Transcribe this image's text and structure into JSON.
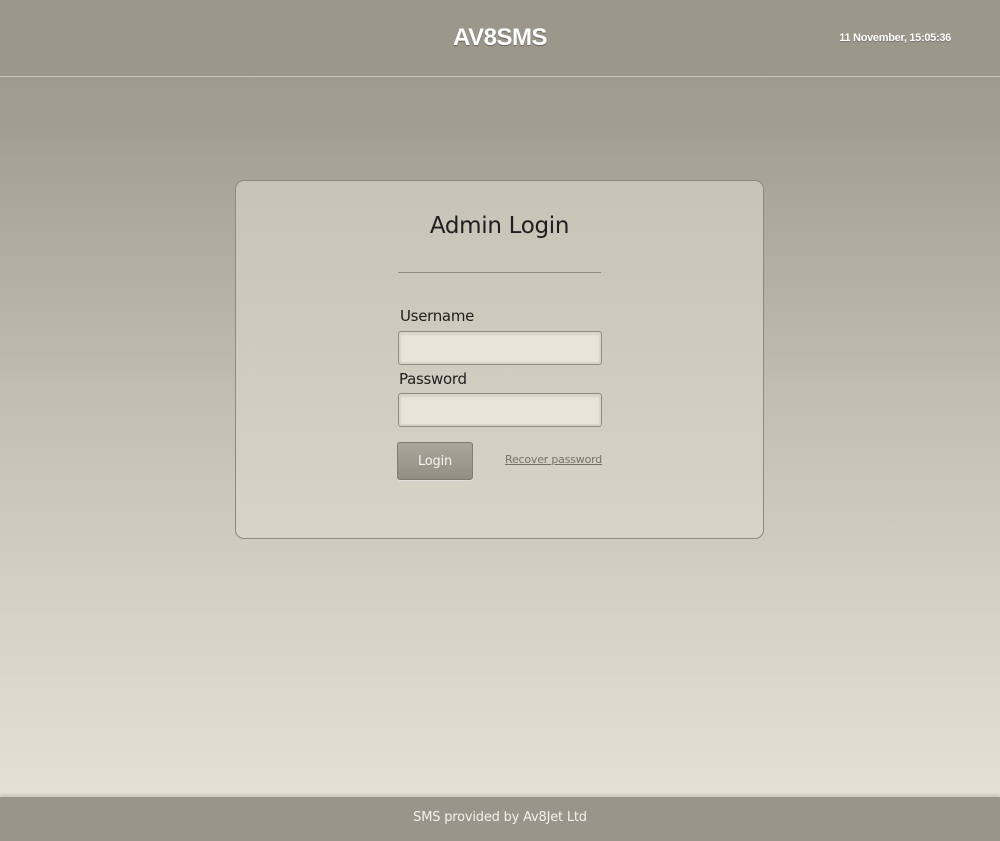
{
  "header": {
    "app_title": "AV8SMS",
    "datetime": "11 November, 15:05:36"
  },
  "login": {
    "title": "Admin Login",
    "username_label": "Username",
    "username_value": "",
    "password_label": "Password",
    "password_value": "",
    "login_button": "Login",
    "recover_link": "Recover password"
  },
  "footer": {
    "text": "SMS provided by Av8Jet Ltd"
  },
  "colors": {
    "header_bg": "#9b978b",
    "panel_bg": "#cfccbf",
    "button_bg": "#9c988d",
    "footer_bg": "#99958a"
  }
}
